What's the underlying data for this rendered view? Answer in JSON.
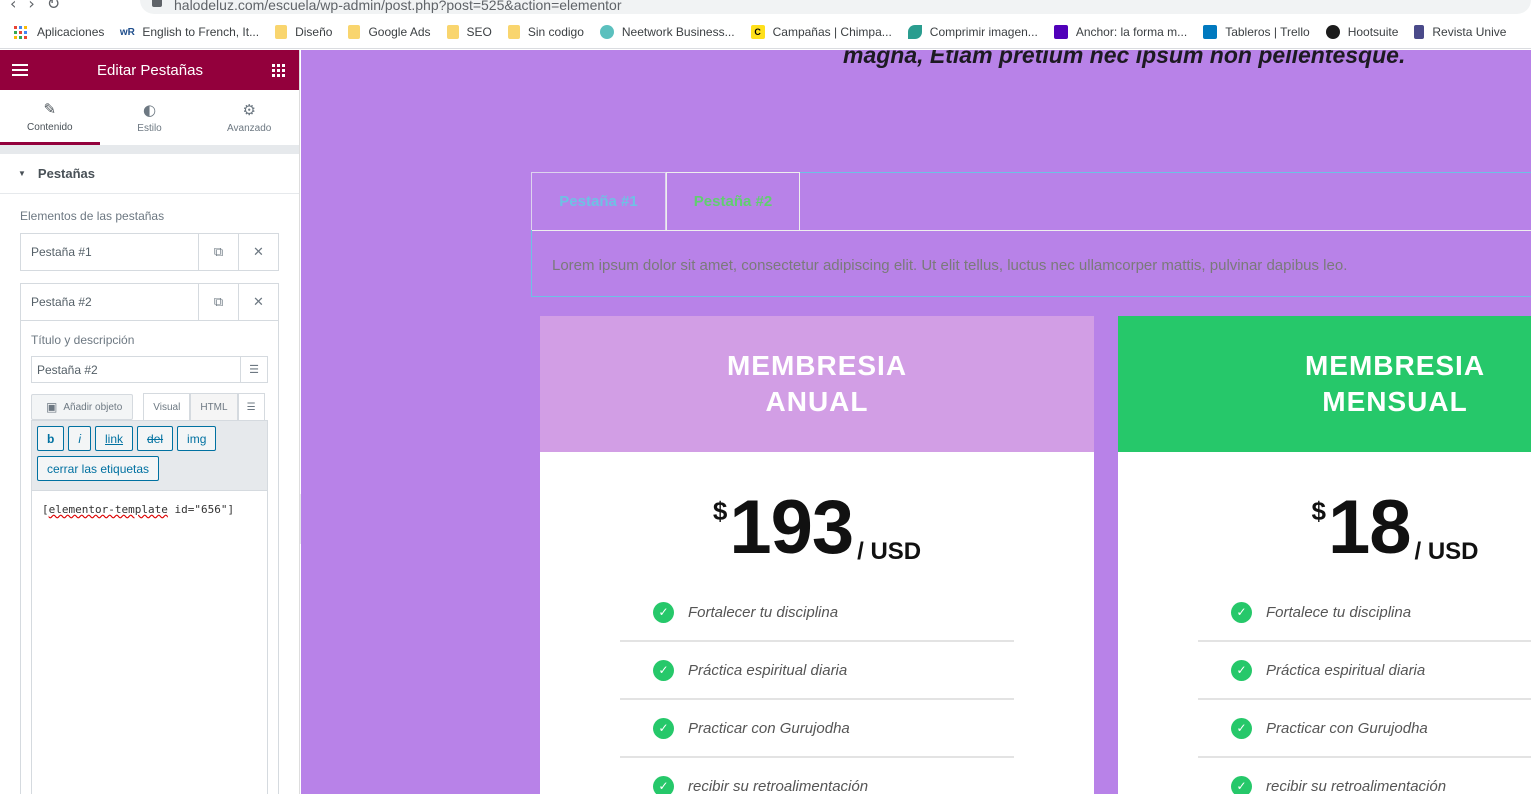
{
  "browser": {
    "url": "halodeluz.com/escuela/wp-admin/post.php?post=525&action=elementor",
    "bookmarks": [
      {
        "label": "Aplicaciones",
        "icon": "apps-icon"
      },
      {
        "label": "English to French, It...",
        "icon": "wr-icon"
      },
      {
        "label": "Diseño",
        "icon": "folder-icon"
      },
      {
        "label": "Google Ads",
        "icon": "folder-icon"
      },
      {
        "label": "SEO",
        "icon": "folder-icon"
      },
      {
        "label": "Sin codigo",
        "icon": "folder-icon"
      },
      {
        "label": "Neetwork Business...",
        "icon": "neetwork-icon"
      },
      {
        "label": "Campañas | Chimpa...",
        "icon": "mailchimp-icon"
      },
      {
        "label": "Comprimir imagen...",
        "icon": "leaf-icon"
      },
      {
        "label": "Anchor: la forma m...",
        "icon": "anchor-icon"
      },
      {
        "label": "Tableros | Trello",
        "icon": "trello-icon"
      },
      {
        "label": "Hootsuite",
        "icon": "hootsuite-icon"
      },
      {
        "label": "Revista Unive",
        "icon": "book-icon"
      }
    ]
  },
  "panel": {
    "title": "Editar Pestañas",
    "tabs": [
      {
        "label": "Contenido",
        "icon": "pencil-icon"
      },
      {
        "label": "Estilo",
        "icon": "contrast-icon"
      },
      {
        "label": "Avanzado",
        "icon": "gear-icon"
      }
    ],
    "section_title": "Pestañas",
    "repeater_label": "Elementos de las pestañas",
    "items": [
      {
        "title": "Pestaña #1"
      },
      {
        "title": "Pestaña #2"
      }
    ],
    "field_label": "Título y descripción",
    "title_value": "Pestaña #2",
    "add_media_label": "Añadir objeto",
    "editor_tab_visual": "Visual",
    "editor_tab_html": "HTML",
    "quicktags": [
      "b",
      "i",
      "link",
      "del",
      "img",
      "cerrar las etiquetas"
    ],
    "code_prefix": "[",
    "code_word": "elementor-template",
    "code_suffix": " id=\"656\"]"
  },
  "canvas": {
    "hero_text": "magna, Etiam pretium nec ipsum non pellentesque.",
    "tab1_label": "Pestaña #1",
    "tab2_label": "Pestaña #2",
    "tab_content": "Lorem ipsum dolor sit amet, consectetur adipiscing elit. Ut elit tellus, luctus nec ullamcorper mattis, pulvinar dapibus leo.",
    "cards": [
      {
        "title_line1": "MEMBRESIA",
        "title_line2": "ANUAL",
        "currency": "$",
        "amount": "193",
        "period": "/ USD",
        "features": [
          "Fortalecer tu disciplina",
          "Práctica espiritual diaria",
          "Practicar con Gurujodha",
          "recibir su retroalimentación"
        ]
      },
      {
        "title_line1": "MEMBRESIA",
        "title_line2": "MENSUAL",
        "currency": "$",
        "amount": "18",
        "period": "/ USD",
        "features": [
          "Fortalece tu disciplina",
          "Práctica espiritual diaria",
          "Practicar con Gurujodha",
          "recibir su retroalimentación"
        ]
      }
    ]
  },
  "colors": {
    "elementor_header": "#93003c",
    "canvas_bg": "#b882e8",
    "card1_header": "#d29ee5",
    "card2_header": "#26c86a",
    "check": "#26c86a"
  }
}
